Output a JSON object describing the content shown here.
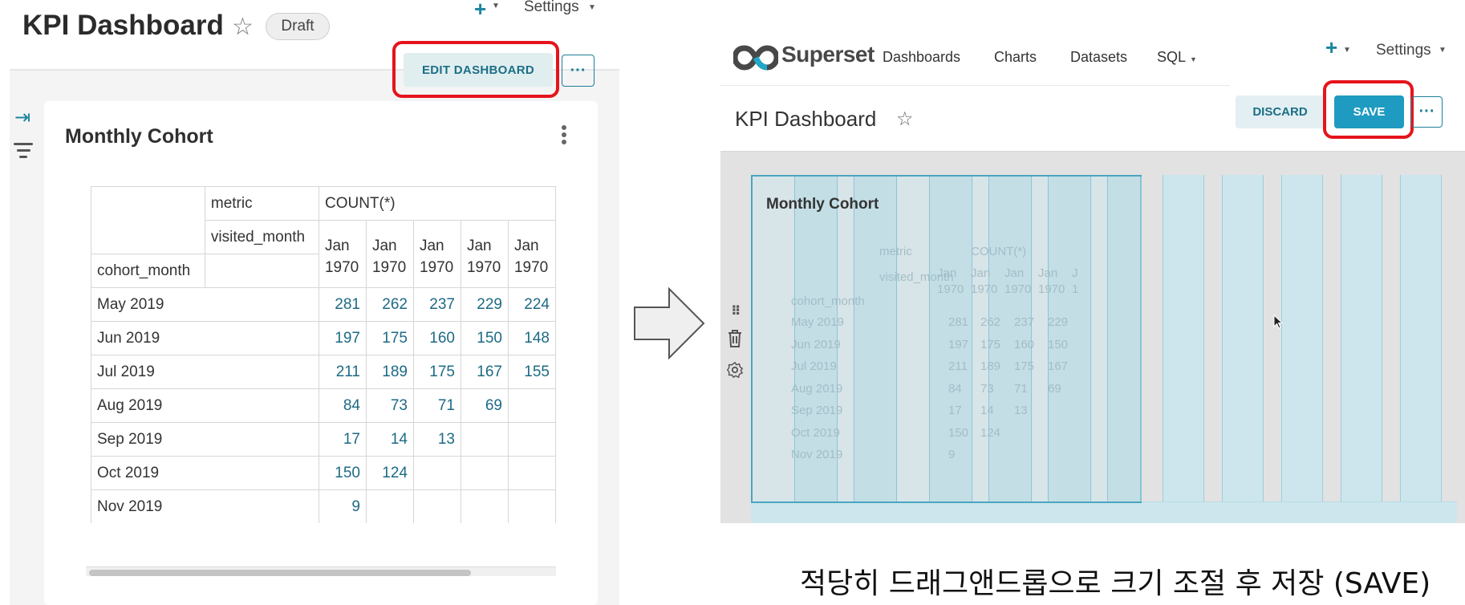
{
  "left": {
    "title": "KPI Dashboard",
    "badge": "Draft",
    "settings": "Settings",
    "edit_button": "EDIT DASHBOARD",
    "more_button": "···",
    "chart_title": "Monthly Cohort",
    "table": {
      "metric_label": "metric",
      "metric_value": "COUNT(*)",
      "visited_label": "visited_month",
      "row_header": "cohort_month",
      "columns": [
        "Jan 1970",
        "Jan 1970",
        "Jan 1970",
        "Jan 1970",
        "Jan 1970"
      ],
      "rows": [
        {
          "label": "May 2019",
          "values": [
            "281",
            "262",
            "237",
            "229",
            "224"
          ]
        },
        {
          "label": "Jun 2019",
          "values": [
            "197",
            "175",
            "160",
            "150",
            "148"
          ]
        },
        {
          "label": "Jul 2019",
          "values": [
            "211",
            "189",
            "175",
            "167",
            "155"
          ]
        },
        {
          "label": "Aug 2019",
          "values": [
            "84",
            "73",
            "71",
            "69",
            ""
          ]
        },
        {
          "label": "Sep 2019",
          "values": [
            "17",
            "14",
            "13",
            "",
            ""
          ]
        },
        {
          "label": "Oct 2019",
          "values": [
            "150",
            "124",
            "",
            "",
            ""
          ]
        },
        {
          "label": "Nov 2019",
          "values": [
            "9",
            "",
            "",
            "",
            ""
          ]
        }
      ]
    }
  },
  "right": {
    "brand": "Superset",
    "nav": [
      "Dashboards",
      "Charts",
      "Datasets",
      "SQL"
    ],
    "settings": "Settings",
    "title": "KPI Dashboard",
    "discard_button": "DISCARD",
    "save_button": "SAVE",
    "more_button": "···",
    "chart_title": "Monthly Cohort",
    "ghost": {
      "metric_label": "metric",
      "metric_value": "COUNT(*)",
      "visited_label": "visited_month",
      "row_header": "cohort_month",
      "col_top": "Jan",
      "col_bottom": "1970",
      "extra_col_top": "J",
      "extra_col_bottom": "1",
      "rows": [
        {
          "label": "May 2019",
          "values": [
            "281",
            "262",
            "237",
            "229"
          ]
        },
        {
          "label": "Jun 2019",
          "values": [
            "197",
            "175",
            "160",
            "150"
          ]
        },
        {
          "label": "Jul 2019",
          "values": [
            "211",
            "189",
            "175",
            "167"
          ]
        },
        {
          "label": "Aug 2019",
          "values": [
            "84",
            "73",
            "71",
            "69"
          ]
        },
        {
          "label": "Sep 2019",
          "values": [
            "17",
            "14",
            "13",
            ""
          ]
        },
        {
          "label": "Oct 2019",
          "values": [
            "150",
            "124",
            "",
            ""
          ]
        },
        {
          "label": "Nov 2019",
          "values": [
            "9",
            "",
            "",
            ""
          ]
        }
      ]
    }
  },
  "caption": "적당히 드래그앤드롭으로 크기 조절 후 저장 (SAVE)",
  "colors": {
    "accent": "#1f9bc1",
    "highlight": "#e5141c",
    "link": "#1d6a84"
  }
}
